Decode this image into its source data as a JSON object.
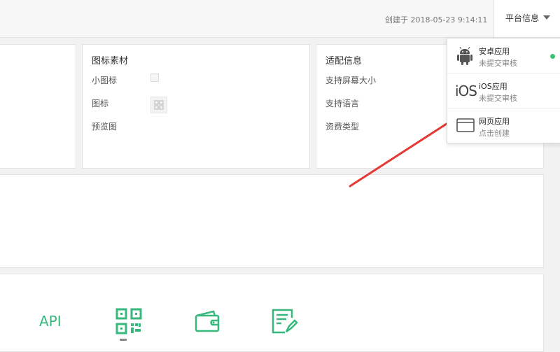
{
  "header": {
    "created": "创建于 2018-05-23 9:14:11",
    "platform_menu_label": "平台信息"
  },
  "assets_card": {
    "title": "图标素材",
    "rows": [
      "小图标",
      "图标",
      "预览图"
    ]
  },
  "adapt_card": {
    "title": "适配信息",
    "rows": [
      "支持屏幕大小",
      "支持语言",
      "资费类型"
    ]
  },
  "tools": {
    "api_label": "API",
    "icons": [
      "qr-code-icon",
      "wallet-icon",
      "edit-document-icon"
    ]
  },
  "platform_dropdown": {
    "items": [
      {
        "name": "安卓应用",
        "status": "未提交审核",
        "icon": "android-icon",
        "active": true
      },
      {
        "name": "iOS应用",
        "status": "未提交审核",
        "icon": "ios-icon",
        "icon_text": "iOS"
      },
      {
        "name": "网页应用",
        "status": "点击创建",
        "icon": "browser-window-icon"
      }
    ]
  },
  "colors": {
    "accent_green": "#38b87c",
    "status_green": "#3cbf73",
    "arrow_red": "#e53935"
  }
}
